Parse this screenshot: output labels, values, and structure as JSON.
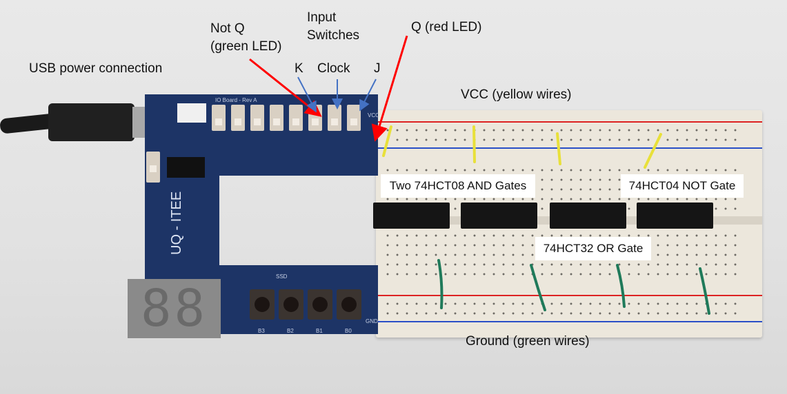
{
  "annotations": {
    "usb": "USB power connection",
    "not_q_line1": "Not Q",
    "not_q_line2": "(green LED)",
    "input_line1": "Input",
    "input_line2": "Switches",
    "k": "K",
    "clock": "Clock",
    "j": "J",
    "q": "Q (red LED)",
    "vcc": "VCC (yellow wires)",
    "ground": "Ground (green wires)"
  },
  "chip_labels": {
    "and_gates": "Two 74HCT08 AND Gates",
    "not_gate": "74HCT04 NOT Gate",
    "or_gate": "74HCT32 OR Gate"
  },
  "board": {
    "title": "IO Board - Rev A",
    "brand": "UQ - ITEE",
    "ssd": "SSD",
    "vcc": "VCC",
    "gnd": "GND",
    "buttons": [
      "B3",
      "B2",
      "B1",
      "B0"
    ],
    "display": "88"
  },
  "colors": {
    "arrow_red": "#ff0000",
    "arrow_blue": "#4472c4",
    "board_blue": "#1d3466",
    "vcc_wire": "#e8e03a",
    "ground_wire": "#1f7a5a"
  }
}
